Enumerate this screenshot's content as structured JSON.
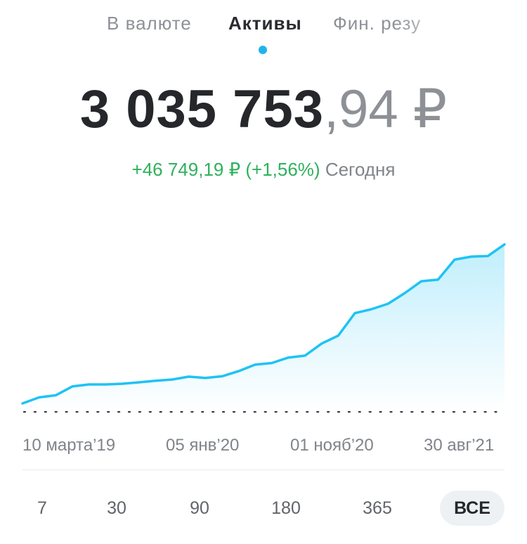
{
  "tabs": [
    {
      "label": "В валюте",
      "active": false
    },
    {
      "label": "Активы",
      "active": true
    },
    {
      "label": "Фин. резу",
      "active": false
    }
  ],
  "balance": {
    "integer": "3 035 753",
    "fraction": ",94 ₽"
  },
  "change": {
    "delta": "+46 749,19 ₽ (+1,56%)",
    "period": "Сегодня"
  },
  "colors": {
    "accent": "#1fb3ec",
    "line": "#1ec3f4",
    "positive": "#2fb15d",
    "muted": "#8d9196"
  },
  "chart_data": {
    "type": "area",
    "x": [
      "10 марта’19",
      "05 янв’20",
      "01 нояб’20",
      "30 авг’21"
    ],
    "series": [
      {
        "values": [
          0,
          0.034,
          0.046,
          0.096,
          0.107,
          0.107,
          0.111,
          0.119,
          0.128,
          0.135,
          0.151,
          0.144,
          0.153,
          0.182,
          0.219,
          0.228,
          0.259,
          0.27,
          0.338,
          0.383,
          0.51,
          0.532,
          0.563,
          0.623,
          0.69,
          0.699,
          0.812,
          0.829,
          0.832,
          0.898
        ]
      }
    ],
    "xlabel": "",
    "ylabel": "",
    "grid": false,
    "legend": "none"
  },
  "date_labels": [
    "10 марта’19",
    "05 янв’20",
    "01 нояб’20",
    "30 авг’21"
  ],
  "periods": [
    {
      "label": "7",
      "active": false
    },
    {
      "label": "30",
      "active": false
    },
    {
      "label": "90",
      "active": false
    },
    {
      "label": "180",
      "active": false
    },
    {
      "label": "365",
      "active": false
    },
    {
      "label": "ВСЕ",
      "active": true
    }
  ]
}
